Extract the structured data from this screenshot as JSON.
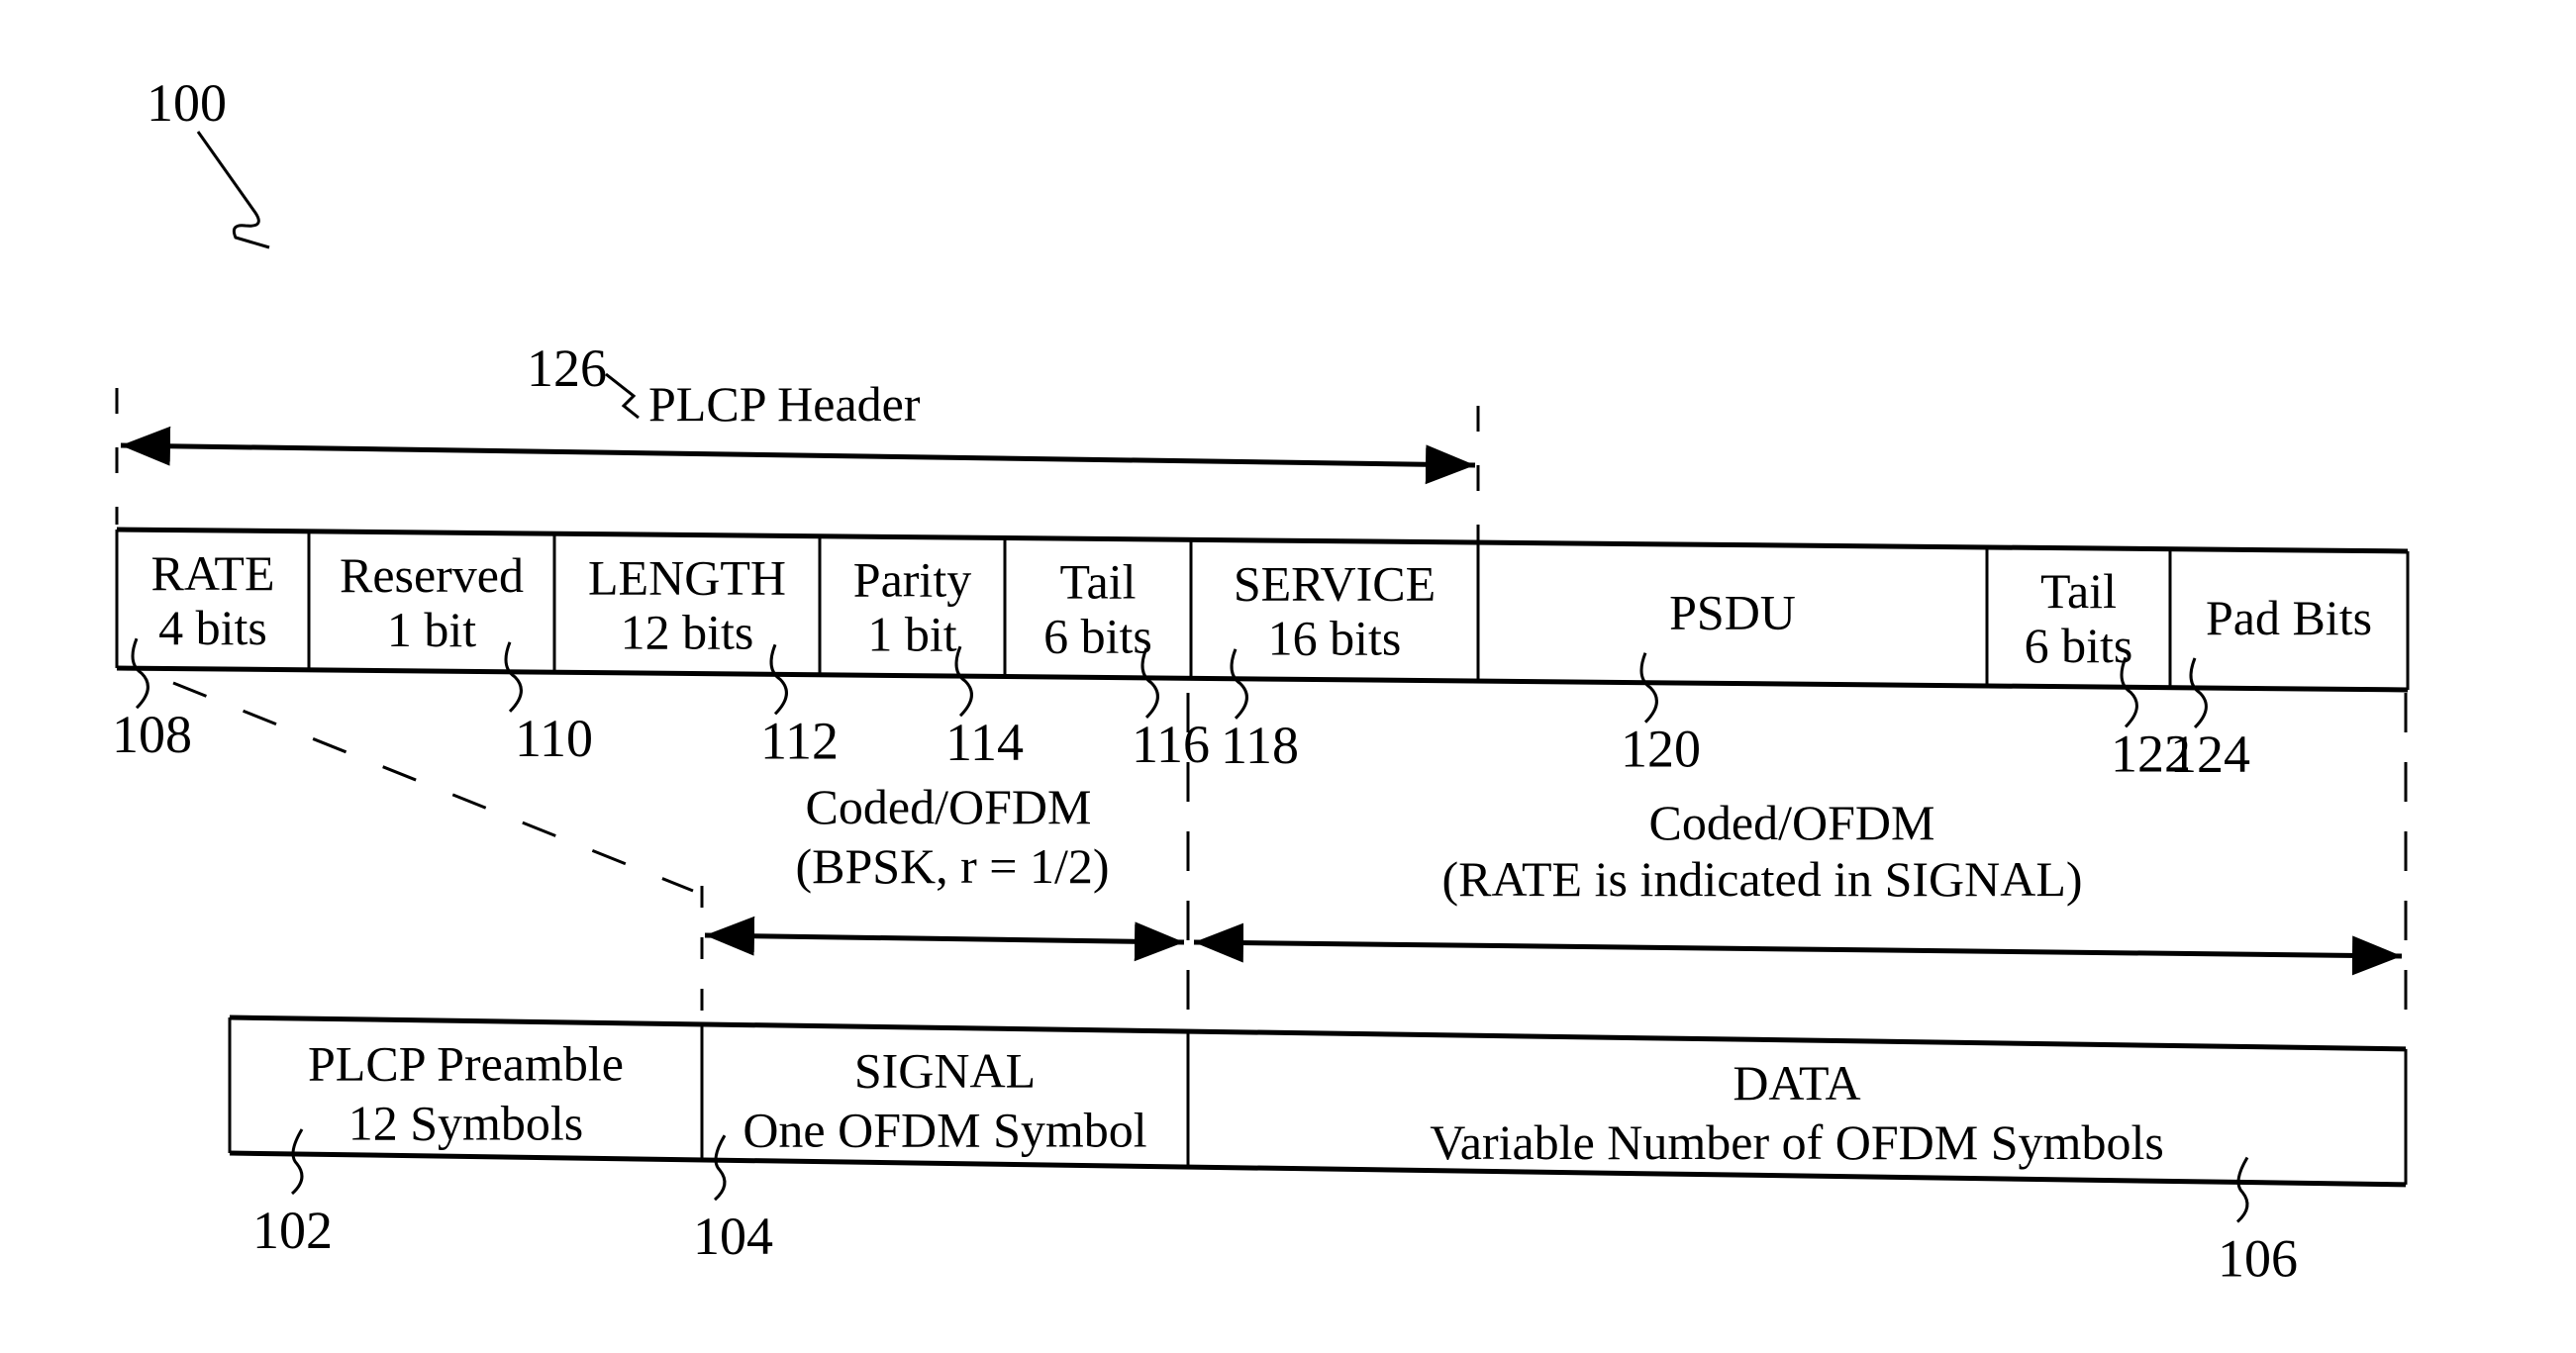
{
  "figure": {
    "ref": "100"
  },
  "plcp_header": {
    "ref": "126",
    "label": "PLCP Header"
  },
  "top_fields": [
    {
      "line1": "RATE",
      "line2": "4 bits",
      "ref": "108"
    },
    {
      "line1": "Reserved",
      "line2": "1 bit",
      "ref": "110"
    },
    {
      "line1": "LENGTH",
      "line2": "12 bits",
      "ref": "112"
    },
    {
      "line1": "Parity",
      "line2": "1 bit",
      "ref": "114"
    },
    {
      "line1": "Tail",
      "line2": "6 bits",
      "ref": "116"
    },
    {
      "line1": "SERVICE",
      "line2": "16 bits",
      "ref": "118"
    },
    {
      "line1": "PSDU",
      "line2": "",
      "ref": "120"
    },
    {
      "line1": "Tail",
      "line2": "6 bits",
      "ref": "122"
    },
    {
      "line1": "Pad Bits",
      "line2": "",
      "ref": "124"
    }
  ],
  "coding": {
    "signal": {
      "line1": "Coded/OFDM",
      "line2": "(BPSK, r = 1/2)"
    },
    "data": {
      "line1": "Coded/OFDM",
      "line2": "(RATE is indicated in SIGNAL)"
    }
  },
  "bottom_fields": [
    {
      "line1": "PLCP Preamble",
      "line2": "12 Symbols",
      "ref": "102"
    },
    {
      "line1": "SIGNAL",
      "line2": "One OFDM Symbol",
      "ref": "104"
    },
    {
      "line1": "DATA",
      "line2": "Variable Number of OFDM Symbols",
      "ref": "106"
    }
  ]
}
